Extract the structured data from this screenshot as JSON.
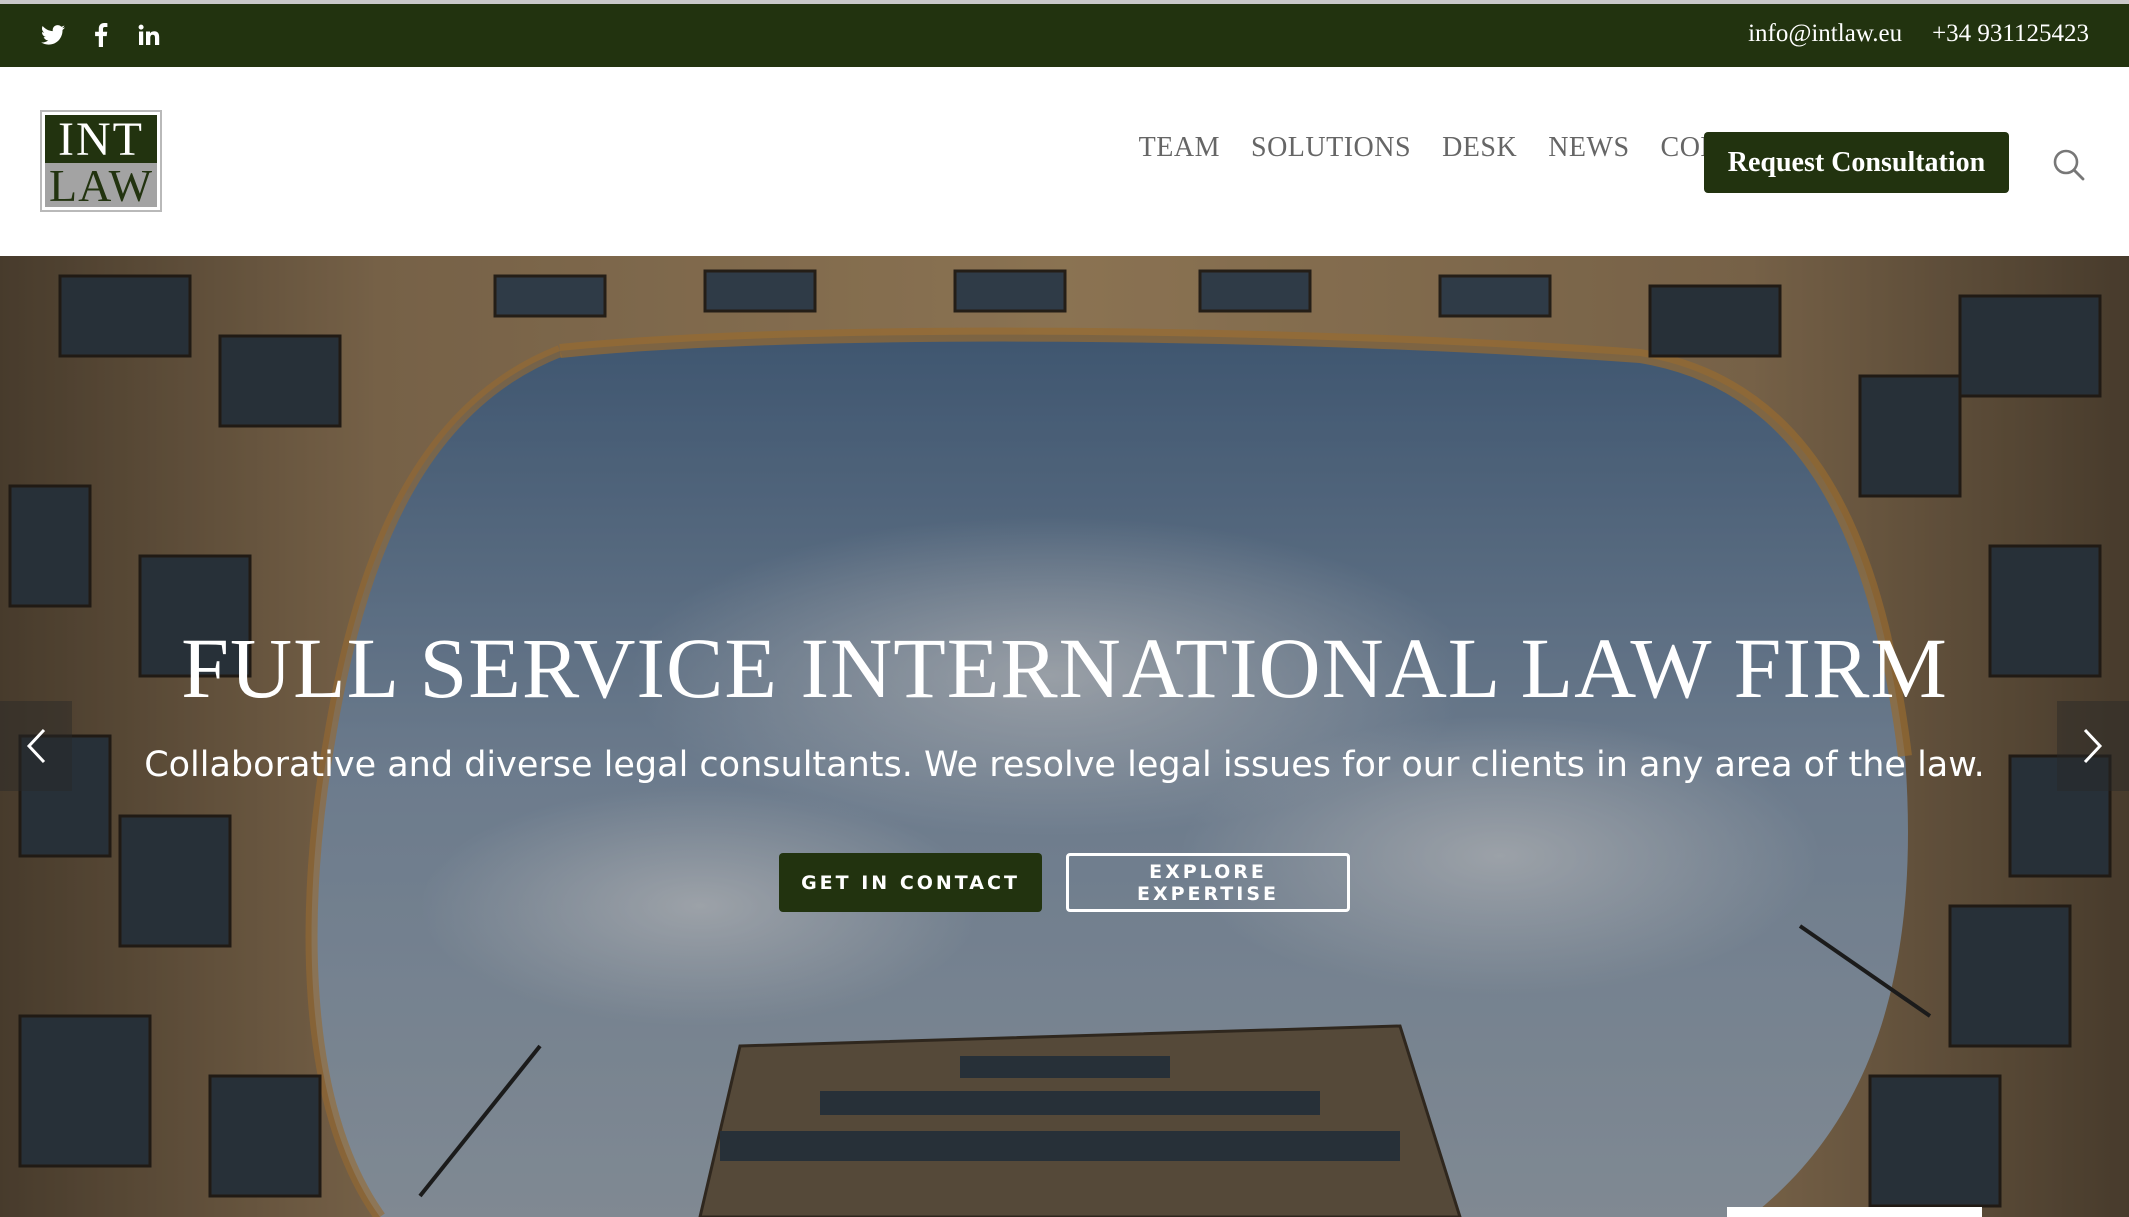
{
  "topbar": {
    "social": [
      {
        "name": "twitter-icon"
      },
      {
        "name": "facebook-icon"
      },
      {
        "name": "linkedin-icon"
      }
    ],
    "email": "info@intlaw.eu",
    "phone": "+34 931125423"
  },
  "header": {
    "logo_top": "INT",
    "logo_bottom": "LAW",
    "nav": [
      "TEAM",
      "SOLUTIONS",
      "DESK",
      "NEWS",
      "CONTACT"
    ],
    "cta_label": "Request Consultation",
    "search_icon": "search-icon"
  },
  "hero": {
    "title": "FULL SERVICE INTERNATIONAL LAW FIRM",
    "subtitle": "Collaborative and diverse legal consultants. We resolve legal issues for our clients in any area of the law.",
    "primary_button": "GET IN CONTACT",
    "secondary_button": "EXPLORE EXPERTISE",
    "prev_icon": "chevron-left-icon",
    "next_icon": "chevron-right-icon"
  },
  "colors": {
    "brand_green": "#22330f",
    "nav_text": "#666666",
    "logo_gray": "#a3a3a3"
  }
}
